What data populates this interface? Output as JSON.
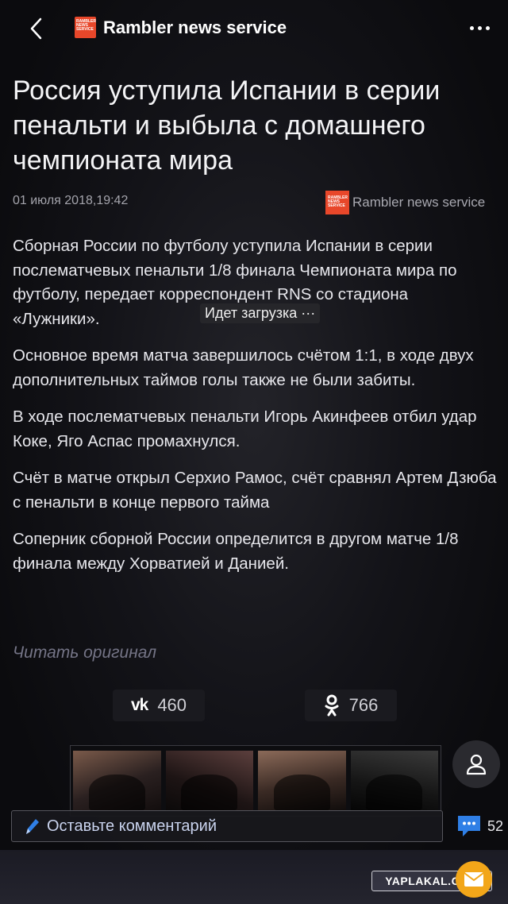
{
  "header": {
    "title": "Rambler news service",
    "logo_text": "RAMBLER NEWS SERVICE"
  },
  "article": {
    "title": "Россия уступила Испании в серии пенальти и выбыла с домашнего чемпионата мира",
    "date": "01 июля 2018,19:42",
    "source": "Rambler news service",
    "paragraphs": [
      "Сборная России по футболу уступила Испании в серии послематчевых пенальти 1/8 финала Чемпионата мира по футболу, передает корреспондент RNS со стадиона «Лужники».",
      "Основное время матча завершилось счётом 1:1, в ходе двух дополнительных таймов голы также не были забиты.",
      "В ходе послематчевых пенальти Игорь Акинфеев отбил удар Коке, Яго Аспас промахнулся.",
      "Счёт в матче открыл Серхио Рамос, счёт сравнял Артем Дзюба с пенальти в конце первого тайма",
      "Соперник сборной России определится в другом матче 1/8 финала между Хорватией и Данией."
    ],
    "loading_text": "Идет загрузка ···",
    "read_original": "Читать оригинал"
  },
  "share": {
    "vk_count": "460",
    "ok_count": "766"
  },
  "comments": {
    "placeholder": "Оставьте комментарий",
    "count": "52"
  },
  "watermark": "YAPLAKAL.COM",
  "colors": {
    "logo": "#e8472a",
    "badge": "#f2a619",
    "comment_icon": "#2f7fe6"
  }
}
